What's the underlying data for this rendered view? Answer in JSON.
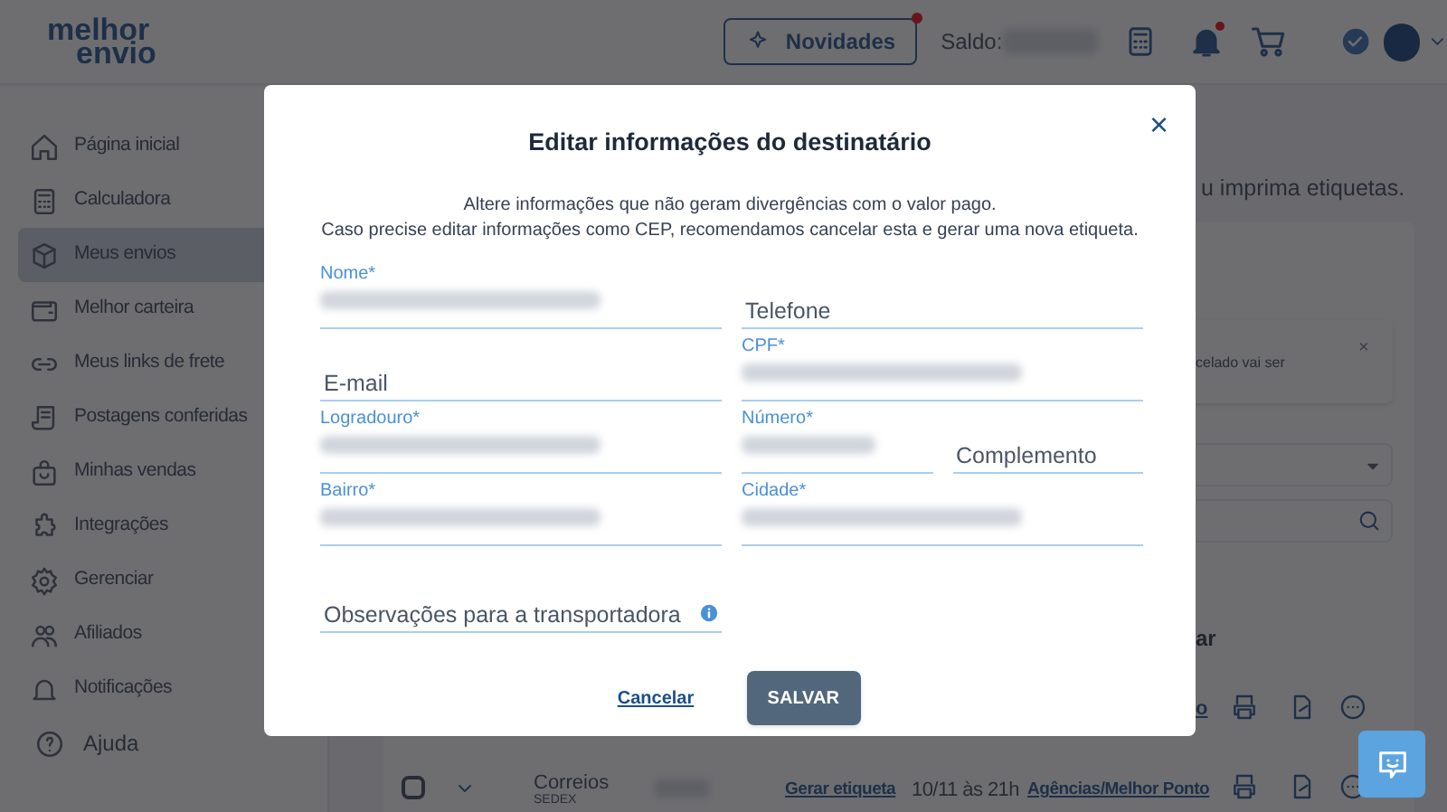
{
  "header": {
    "logo": [
      "melhor",
      "envio"
    ],
    "news_button": {
      "label": "Novidades",
      "badge": true
    },
    "balance_label": "Saldo:",
    "notifications_badge": true
  },
  "sidebar": {
    "items": [
      {
        "label": "Página inicial",
        "selected": false
      },
      {
        "label": "Calculadora",
        "selected": false
      },
      {
        "label": "Meus envios",
        "selected": true
      },
      {
        "label": "Melhor carteira",
        "selected": false
      },
      {
        "label": "Meus links de frete",
        "selected": false
      },
      {
        "label": "Postagens conferidas",
        "selected": false
      },
      {
        "label": "Minhas vendas",
        "selected": false
      },
      {
        "label": "Integrações",
        "selected": false
      },
      {
        "label": "Gerenciar",
        "selected": false
      },
      {
        "label": "Afiliados",
        "selected": false
      },
      {
        "label": "Notificações",
        "selected": false
      }
    ],
    "footer": {
      "label": "Ajuda"
    }
  },
  "content": {
    "subtitle_fragment": "u imprima etiquetas.",
    "notice_fragment": "celado vai ser",
    "notice_close": "×",
    "heading_fragment": "ar",
    "link_fragment": "o",
    "shipment": {
      "checked": false,
      "carrier": "Correios",
      "service": "SEDEX",
      "action": "Gerar etiqueta",
      "deadline": "10/11 às 21h",
      "dropoff": "Agências/Melhor Ponto"
    }
  },
  "modal": {
    "title": "Editar informações do destinatário",
    "close": "×",
    "description": [
      "Altere informações que não geram divergências com o valor pago.",
      "Caso precise editar informações como CEP, recomendamos cancelar esta e gerar uma nova etiqueta."
    ],
    "fields": [
      {
        "kind": "redacted",
        "label": "Nome*"
      },
      {
        "kind": "empty",
        "placeholder": "Telefone"
      },
      {
        "kind": "empty",
        "placeholder": "E-mail"
      },
      {
        "kind": "redacted",
        "label": "CPF*"
      },
      {
        "kind": "redacted",
        "label": "Logradouro*"
      },
      {
        "kind": "redacted",
        "label": "Número*"
      },
      {
        "kind": "empty",
        "placeholder": "Complemento"
      },
      {
        "kind": "redacted",
        "label": "Bairro*"
      },
      {
        "kind": "redacted",
        "label": "Cidade*"
      },
      {
        "kind": "empty",
        "placeholder": "Observações para a transportadora",
        "info": true
      }
    ],
    "cancel": "Cancelar",
    "save": "SALVAR"
  }
}
